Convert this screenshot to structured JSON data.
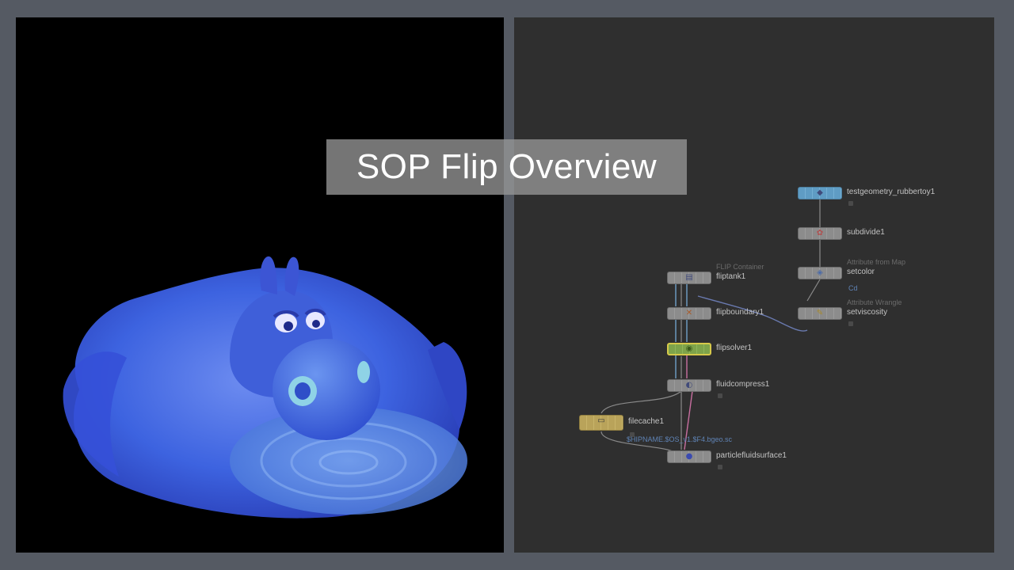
{
  "title": "SOP Flip Overview",
  "nodes": {
    "testgeometry": {
      "name": "testgeometry_rubbertoy1"
    },
    "subdivide": {
      "name": "subdivide1"
    },
    "setcolor": {
      "name": "setcolor",
      "type_label": "Attribute from Map",
      "attr": "Cd"
    },
    "setviscosity": {
      "name": "setviscosity",
      "type_label": "Attribute Wrangle"
    },
    "fliptank": {
      "name": "fliptank1",
      "type_label": "FLIP Container"
    },
    "flipboundary": {
      "name": "flipboundary1"
    },
    "flipsolver": {
      "name": "flipsolver1"
    },
    "fluidcompress": {
      "name": "fluidcompress1"
    },
    "filecache": {
      "name": "filecache1",
      "path": "$HIPNAME.$OS_v1.$F4.bgeo.sc"
    },
    "particlefluidsurface": {
      "name": "particlefluidsurface1"
    }
  },
  "colors": {
    "background": "#555a63",
    "render_bg": "#000000",
    "network_bg": "#2f2f2f",
    "fluid": "#3d63e0",
    "flipsolver_node": "#7ea34a",
    "filecache_node": "#b9a35a",
    "testgeometry_node": "#6aa6c8"
  }
}
